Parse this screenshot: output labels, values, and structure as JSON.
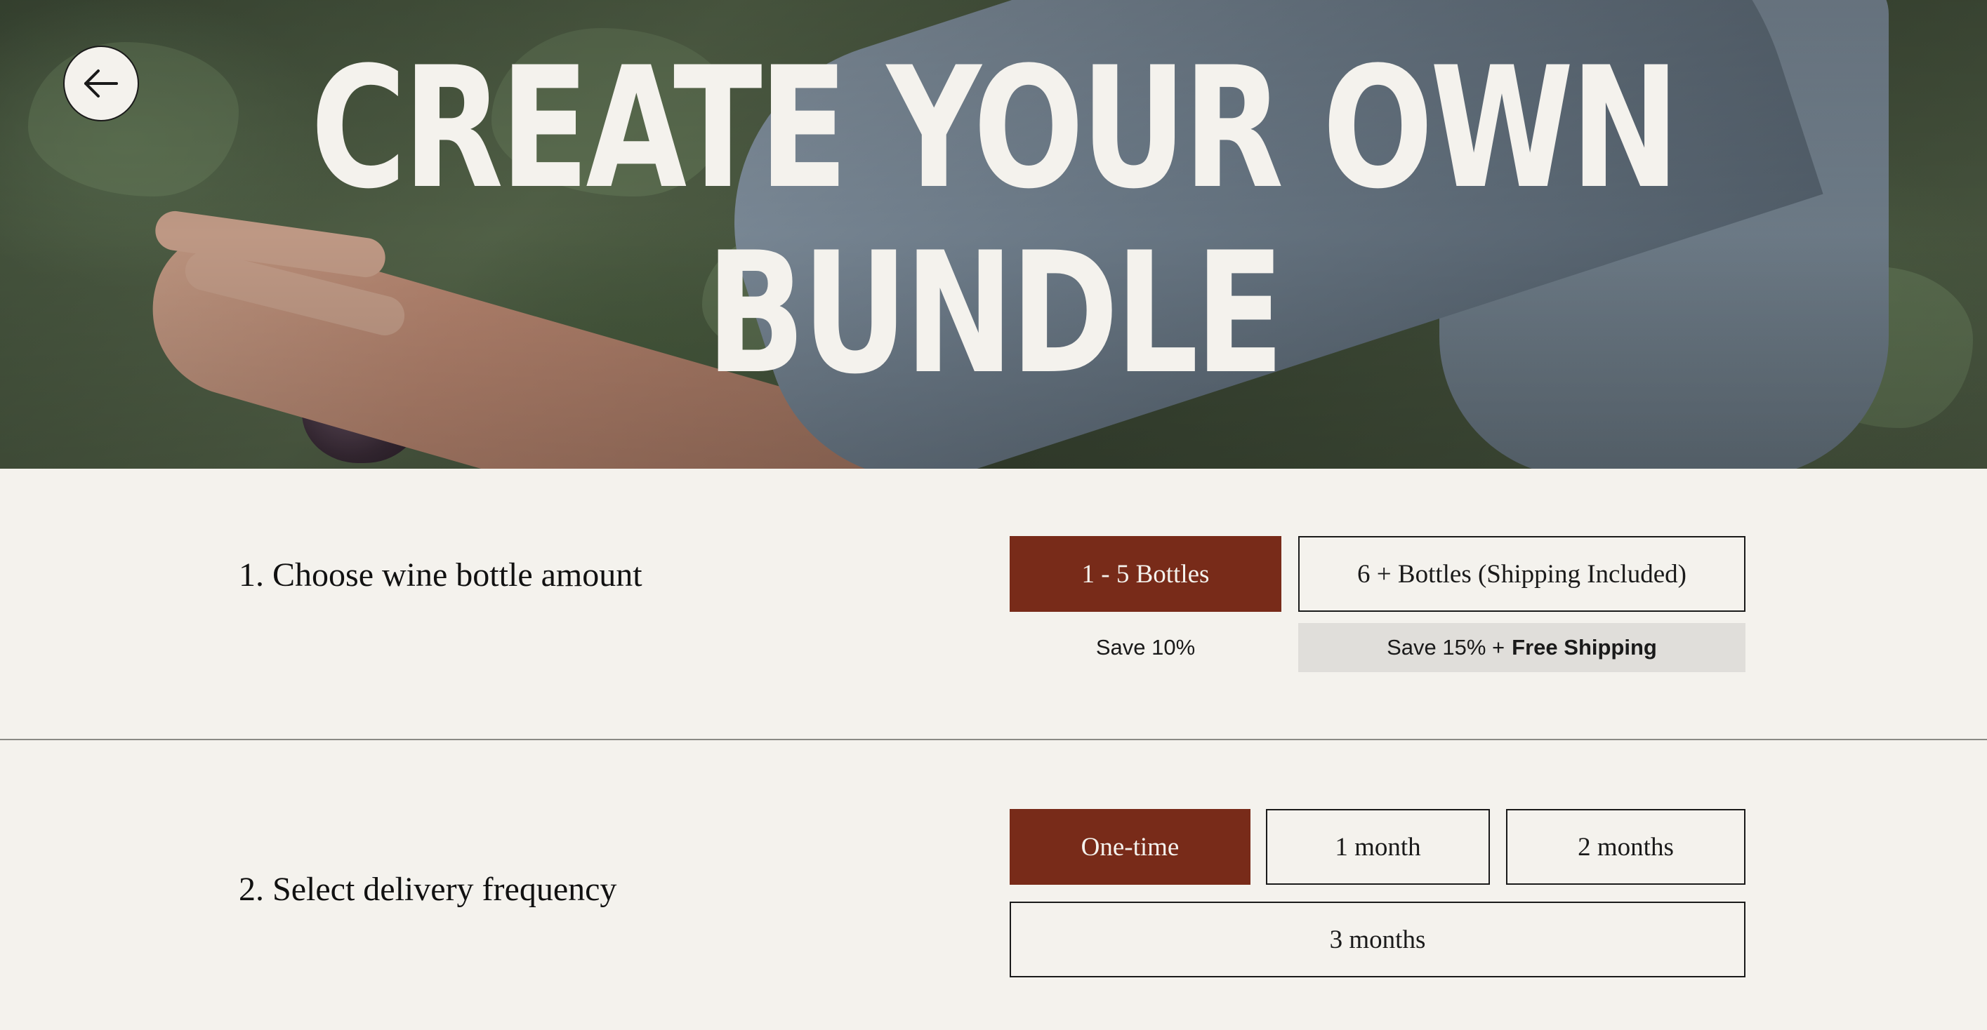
{
  "hero": {
    "title_line1": "CREATE YOUR OWN",
    "title_line2": "BUNDLE",
    "back_icon": "arrow-left-icon"
  },
  "step1": {
    "label": "1. Choose wine bottle amount",
    "options": [
      {
        "label": "1 - 5 Bottles",
        "selected": true
      },
      {
        "label": "6 + Bottles (Shipping Included)",
        "selected": false
      }
    ],
    "notes": {
      "option1": "Save 10%",
      "option2_prefix": "Save 15% +",
      "option2_bold": "Free Shipping"
    }
  },
  "step2": {
    "label": "2. Select delivery frequency",
    "options": [
      {
        "label": "One-time",
        "selected": true
      },
      {
        "label": "1 month",
        "selected": false
      },
      {
        "label": "2 months",
        "selected": false
      },
      {
        "label": "3 months",
        "selected": false
      }
    ]
  },
  "colors": {
    "accent": "#782b19",
    "background": "#f4f2ed",
    "note_background": "#e0deda"
  }
}
